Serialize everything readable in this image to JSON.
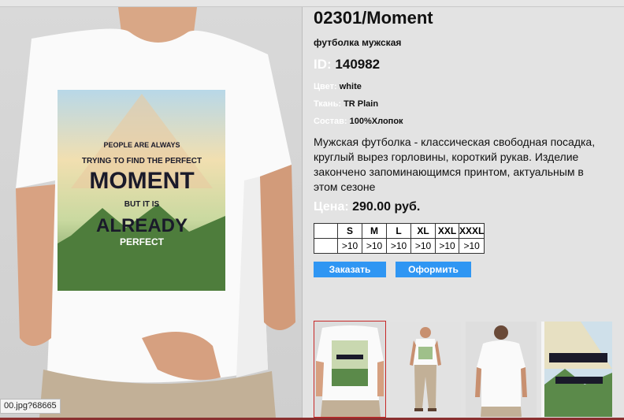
{
  "product": {
    "title": "02301/Moment",
    "subtitle": "футболка мужская",
    "id_label": "ID:",
    "id_value": "140982",
    "color_label": "Цвет:",
    "color_value": "white",
    "fabric_label": "Ткань:",
    "fabric_value": "TR Plain",
    "composition_label": "Состав:",
    "composition_value": "100%Хлопок",
    "description": "Мужская футболка - классическая свободная посадка, круглый вырез горловины, короткий рукав. Изделие закончено запоминающимся принтом, актуальным в этом сезоне",
    "price_label": "Цена:",
    "price_value": "290.00 руб."
  },
  "sizes": {
    "headers": [
      "S",
      "M",
      "L",
      "XL",
      "XXL",
      "XXXL"
    ],
    "availability": [
      ">10",
      ">10",
      ">10",
      ">10",
      ">10",
      ">10"
    ]
  },
  "buttons": {
    "order": "Заказать",
    "checkout": "Оформить"
  },
  "print_text": {
    "line1": "PEOPLE ARE ALWAYS",
    "line2": "TRYING TO FIND THE PERFECT",
    "line3": "MOMENT",
    "line4": "BUT IT IS",
    "line5": "ALREADY",
    "line6": "PERFECT"
  },
  "thumbnails": [
    {
      "name": "thumb-tshirt-closeup",
      "selected": true
    },
    {
      "name": "thumb-full-body-front",
      "selected": false
    },
    {
      "name": "thumb-back-view",
      "selected": false
    },
    {
      "name": "thumb-print-detail",
      "selected": false
    }
  ],
  "status_bar": {
    "url": "00.jpg?68665"
  },
  "colors": {
    "button": "#2f96f3",
    "selected_border": "#c62828",
    "label": "#ffffff"
  }
}
